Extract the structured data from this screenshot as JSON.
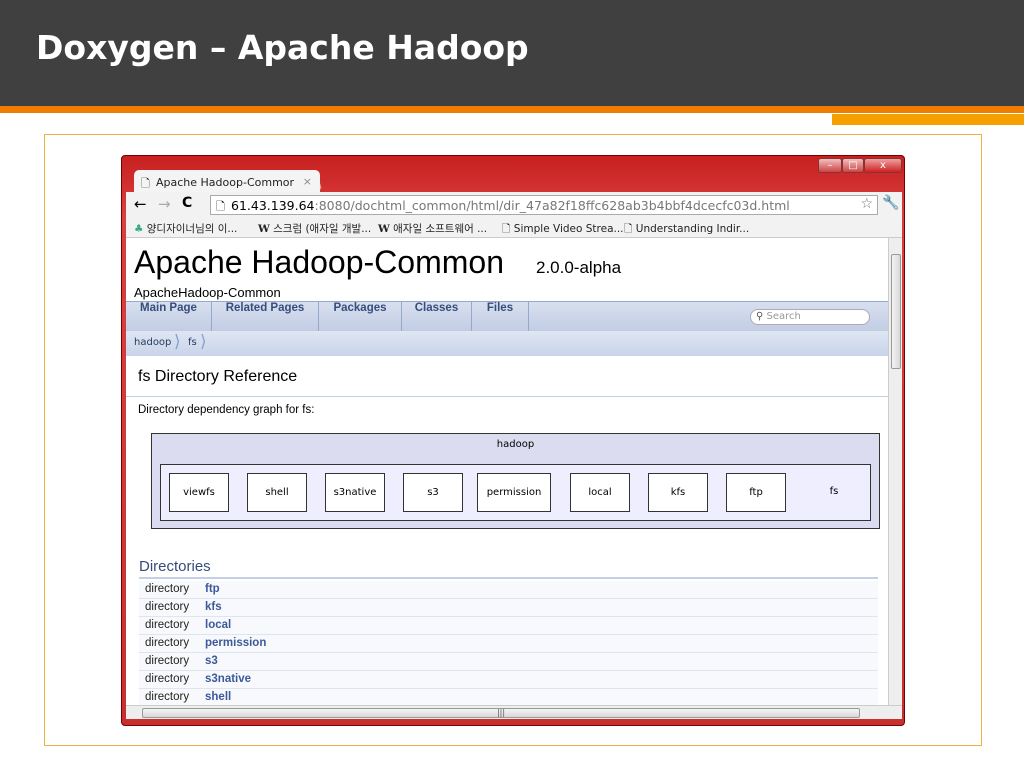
{
  "slide": {
    "title": "Doxygen – Apache Hadoop"
  },
  "browser": {
    "tab_title": "Apache Hadoop-Commor",
    "url_host": "61.43.139.64",
    "url_rest": ":8080/dochtml_common/html/dir_47a82f18ffc628ab3b4bbf4dcecfc03d.html",
    "bookmarks": [
      "양디자이너님의 이...",
      "스크럼 (애자일 개발...",
      "애자일 소프트웨어 ...",
      "Simple Video Strea...",
      "Understanding Indir..."
    ]
  },
  "page": {
    "title": "Apache Hadoop-Common",
    "version": "2.0.0-alpha",
    "subtitle": "ApacheHadoop-Common",
    "nav": [
      "Main Page",
      "Related Pages",
      "Packages",
      "Classes",
      "Files"
    ],
    "search_placeholder": "Search",
    "breadcrumb": [
      "hadoop",
      "fs"
    ],
    "heading": "fs Directory Reference",
    "graph_caption": "Directory dependency graph for fs:",
    "graph": {
      "outer": "hadoop",
      "nodes": [
        "viewfs",
        "shell",
        "s3native",
        "s3",
        "permission",
        "local",
        "kfs",
        "ftp"
      ],
      "current": "fs"
    },
    "directories_title": "Directories",
    "directories": [
      {
        "kind": "directory",
        "name": "ftp"
      },
      {
        "kind": "directory",
        "name": "kfs"
      },
      {
        "kind": "directory",
        "name": "local"
      },
      {
        "kind": "directory",
        "name": "permission"
      },
      {
        "kind": "directory",
        "name": "s3"
      },
      {
        "kind": "directory",
        "name": "s3native"
      },
      {
        "kind": "directory",
        "name": "shell"
      }
    ]
  },
  "colors": {
    "header": "#404040",
    "accent": "#f07c00",
    "browser_frame": "#c82020",
    "link": "#3c5a99"
  }
}
